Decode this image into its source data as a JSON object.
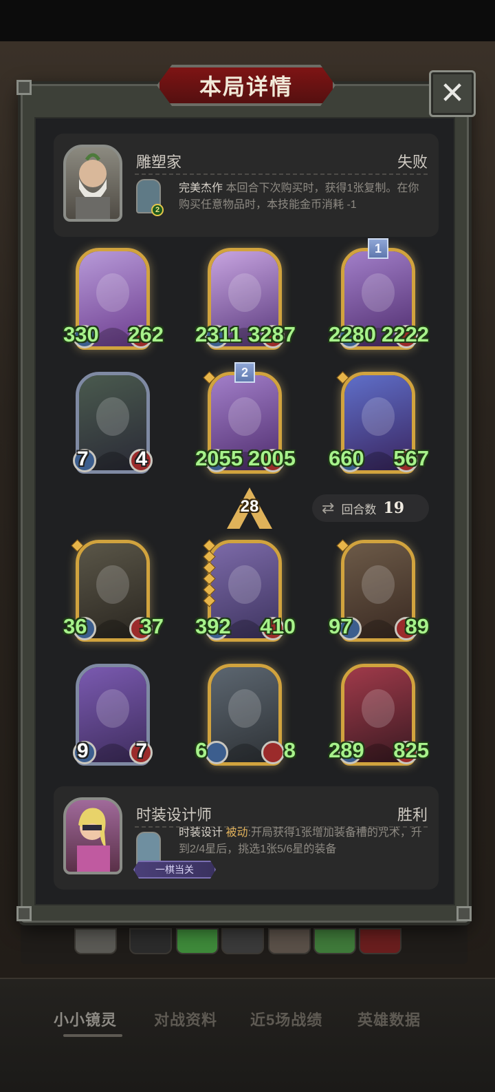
{
  "title": "本局详情",
  "close_label": "✕",
  "opponent": {
    "name": "雕塑家",
    "result": "失败",
    "skill_level": "2",
    "skill_name": "完美杰作",
    "skill_desc": " 本回合下次购买时，获得1张复制。在你购买任意物品时，本技能金币消耗 -1"
  },
  "opponent_board": [
    {
      "atk": "330",
      "hp": "262"
    },
    {
      "atk": "2311",
      "hp": "3287"
    },
    {
      "tier": "1",
      "atk": "2280",
      "hp": "2222"
    },
    {
      "atk": "7",
      "hp": "4"
    },
    {
      "tier": "2",
      "atk": "2055",
      "hp": "2005"
    },
    {
      "atk": "660",
      "hp": "567"
    }
  ],
  "level": "28",
  "round": {
    "label": "回合数",
    "value": "19",
    "icon": "refresh-icon"
  },
  "my_board": [
    {
      "atk": "36",
      "hp": "37"
    },
    {
      "atk": "392",
      "hp": "410"
    },
    {
      "atk": "97",
      "hp": "89"
    },
    {
      "atk": "9",
      "hp": "7"
    },
    {
      "atk": "6",
      "hp": "8"
    },
    {
      "atk": "289",
      "hp": "825"
    }
  ],
  "player": {
    "name": "时装设计师",
    "result": "胜利",
    "badge": "一棋当关",
    "skill_name": "时装设计",
    "skill_type": "被动",
    "skill_desc": ":开局获得1张增加装备槽的咒术，升到2/4星后，挑选1张5/6星的装备"
  },
  "tabs": [
    "小小镜灵",
    "对战资料",
    "近5场战绩",
    "英雄数据"
  ],
  "colors": {
    "stat_text": "#a7f28b",
    "gold_frame": "#d1a33e",
    "title_red": "#7e1414"
  }
}
